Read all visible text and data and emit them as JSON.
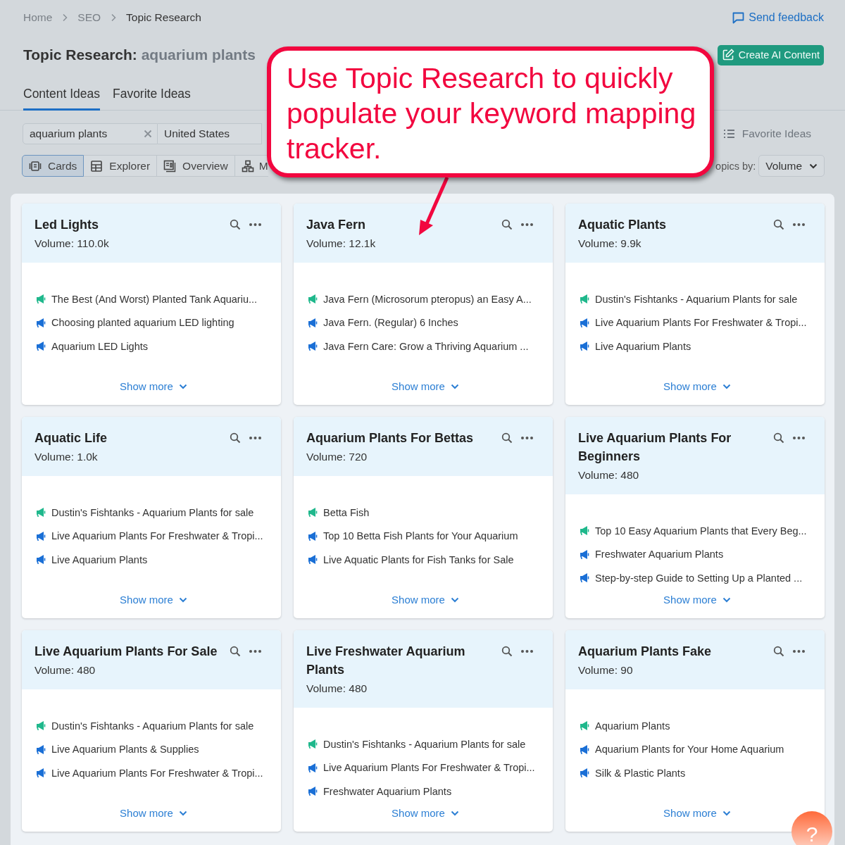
{
  "breadcrumb": [
    "Home",
    "SEO",
    "Topic Research"
  ],
  "feedback_link": "Send feedback",
  "title": {
    "prefix": "Topic Research:",
    "query": "aquarium plants"
  },
  "create_button": "Create AI Content",
  "tabs": [
    {
      "label": "Content Ideas",
      "selected": true
    },
    {
      "label": "Favorite Ideas",
      "selected": false
    }
  ],
  "search": {
    "value": "aquarium plants"
  },
  "country": "United States",
  "favorite_ideas_button": "Favorite Ideas",
  "views": [
    {
      "label": "Cards",
      "kind": "cards",
      "selected": true
    },
    {
      "label": "Explorer",
      "kind": "explorer",
      "selected": false
    },
    {
      "label": "Overview",
      "kind": "overview",
      "selected": false
    },
    {
      "label": "M",
      "kind": "mindmap",
      "selected": false
    }
  ],
  "sort": {
    "label": "opics by:",
    "value": "Volume"
  },
  "callout": "Use Topic Research to quickly populate your keyword mapping tracker.",
  "cards": [
    {
      "title": "Led Lights",
      "volume": "Volume: 110.0k",
      "show_more": "Show more",
      "items": [
        {
          "text": "The Best (And Worst) Planted Tank Aquariu...",
          "color": "#1fb88c"
        },
        {
          "text": "Choosing planted aquarium LED lighting",
          "color": "#1a6fd6"
        },
        {
          "text": "Aquarium LED Lights",
          "color": "#1a6fd6"
        }
      ]
    },
    {
      "title": "Java Fern",
      "volume": "Volume: 12.1k",
      "show_more": "Show more",
      "items": [
        {
          "text": "Java Fern (Microsorum pteropus) an Easy A...",
          "color": "#1fb88c"
        },
        {
          "text": "Java Fern. (Regular) 6 Inches",
          "color": "#1a6fd6"
        },
        {
          "text": "Java Fern Care: Grow a Thriving Aquarium ...",
          "color": "#1a6fd6"
        }
      ]
    },
    {
      "title": "Aquatic Plants",
      "volume": "Volume: 9.9k",
      "show_more": "Show more",
      "items": [
        {
          "text": "Dustin's Fishtanks - Aquarium Plants for sale",
          "color": "#1fb88c"
        },
        {
          "text": "Live Aquarium Plants For Freshwater & Tropi...",
          "color": "#1a6fd6"
        },
        {
          "text": "Live Aquarium Plants",
          "color": "#1a6fd6"
        }
      ]
    },
    {
      "title": "Aquatic Life",
      "volume": "Volume: 1.0k",
      "show_more": "Show more",
      "items": [
        {
          "text": "Dustin's Fishtanks - Aquarium Plants for sale",
          "color": "#1fb88c"
        },
        {
          "text": "Live Aquarium Plants For Freshwater & Tropi...",
          "color": "#1a6fd6"
        },
        {
          "text": "Live Aquarium Plants",
          "color": "#1a6fd6"
        }
      ]
    },
    {
      "title": "Aquarium Plants For Bettas",
      "volume": "Volume: 720",
      "show_more": "Show more",
      "items": [
        {
          "text": "Betta Fish",
          "color": "#1fb88c"
        },
        {
          "text": "Top 10 Betta Fish Plants for Your Aquarium",
          "color": "#1a6fd6"
        },
        {
          "text": "Live Aquatic Plants for Fish Tanks for Sale",
          "color": "#1a6fd6"
        }
      ]
    },
    {
      "title": "Live Aquarium Plants For Beginners",
      "volume": "Volume: 480",
      "show_more": "Show more",
      "items": [
        {
          "text": "Top 10 Easy Aquarium Plants that Every Beg...",
          "color": "#1fb88c"
        },
        {
          "text": "Freshwater Aquarium Plants",
          "color": "#1a6fd6"
        },
        {
          "text": "Step-by-step Guide to Setting Up a Planted ...",
          "color": "#1a6fd6"
        }
      ]
    },
    {
      "title": "Live Aquarium Plants For Sale",
      "volume": "Volume: 480",
      "show_more": "Show more",
      "items": [
        {
          "text": "Dustin's Fishtanks - Aquarium Plants for sale",
          "color": "#1fb88c"
        },
        {
          "text": "Live Aquarium Plants & Supplies",
          "color": "#1a6fd6"
        },
        {
          "text": "Live Aquarium Plants For Freshwater & Tropi...",
          "color": "#1a6fd6"
        }
      ]
    },
    {
      "title": "Live Freshwater Aquarium Plants",
      "volume": "Volume: 480",
      "show_more": "Show more",
      "items": [
        {
          "text": "Dustin's Fishtanks - Aquarium Plants for sale",
          "color": "#1fb88c"
        },
        {
          "text": "Live Aquarium Plants For Freshwater & Tropi...",
          "color": "#1a6fd6"
        },
        {
          "text": "Freshwater Aquarium Plants",
          "color": "#1a6fd6"
        }
      ]
    },
    {
      "title": "Aquarium Plants Fake",
      "volume": "Volume: 90",
      "show_more": "Show more",
      "items": [
        {
          "text": "Aquarium Plants",
          "color": "#1fb88c"
        },
        {
          "text": "Aquarium Plants for Your Home Aquarium",
          "color": "#1a6fd6"
        },
        {
          "text": "Silk & Plastic Plants",
          "color": "#1a6fd6"
        }
      ]
    }
  ],
  "help_button": "?"
}
